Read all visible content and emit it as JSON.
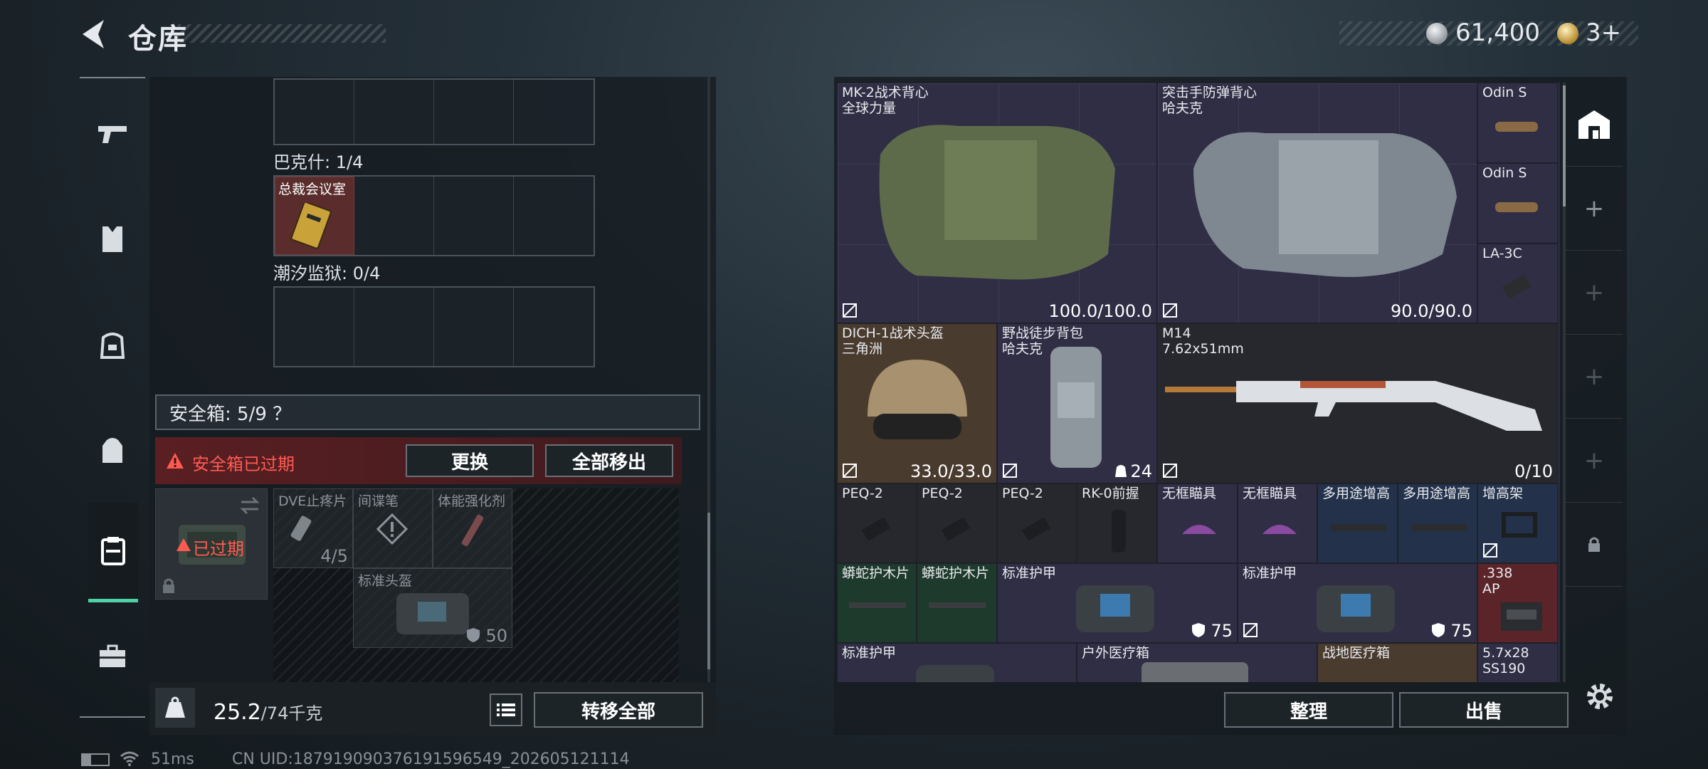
{
  "header": {
    "title": "仓库",
    "silver": "61,400",
    "gold": "3+"
  },
  "left": {
    "bakshi_label": "巴克什: 1/4",
    "key_item_label": "总裁会议室",
    "prison_label": "潮汐监狱: 0/4",
    "safe_label": "安全箱: 5/9 ？",
    "expired_msg": "安全箱已过期",
    "replace_btn": "更换",
    "remove_all_btn": "全部移出",
    "expired_badge": "已过期",
    "safe_items": [
      {
        "name": "DVE止疼片",
        "count": "4/5"
      },
      {
        "name": "间谍笔"
      },
      {
        "name": "体能强化剂"
      },
      {
        "name": "标准头盔",
        "value": "50"
      }
    ],
    "weight_value": "25.2",
    "weight_max": "/74千克",
    "transfer_all_btn": "转移全部"
  },
  "right": {
    "items": [
      {
        "line1": "MK-2战术背心",
        "line2": "全球力量",
        "value": "100.0/100.0"
      },
      {
        "line1": "突击手防弹背心",
        "line2": "哈夫克",
        "value": "90.0/90.0"
      },
      {
        "line1": "Odin S"
      },
      {
        "line1": "Odin S"
      },
      {
        "line1": "LA-3C"
      },
      {
        "line1": "DICH-1战术头盔",
        "line2": "三角洲",
        "value": "33.0/33.0"
      },
      {
        "line1": "野战徒步背包",
        "line2": "哈夫克",
        "value": "24"
      },
      {
        "line1": "M14",
        "line2": "7.62x51mm",
        "value": "0/10"
      },
      {
        "line1": "PEQ-2"
      },
      {
        "line1": "PEQ-2"
      },
      {
        "line1": "PEQ-2"
      },
      {
        "line1": "RK-0前握"
      },
      {
        "line1": "无框瞄具"
      },
      {
        "line1": "无框瞄具"
      },
      {
        "line1": "多用途增高"
      },
      {
        "line1": "多用途增高"
      },
      {
        "line1": "增高架"
      },
      {
        "line1": "蟒蛇护木片"
      },
      {
        "line1": "蟒蛇护木片"
      },
      {
        "line1": "标准护甲",
        "value": "75"
      },
      {
        "line1": "标准护甲",
        "value": "75"
      },
      {
        "line1": ".338",
        "line2": "AP"
      },
      {
        "line1": "标准护甲"
      },
      {
        "line1": "户外医疗箱"
      },
      {
        "line1": "战地医疗箱"
      },
      {
        "line1": "5.7x28",
        "line2": "SS190"
      }
    ],
    "sort_btn": "整理",
    "sell_btn": "出售"
  },
  "status": {
    "ping": "51ms",
    "uid": "CN UID:1879190903761915965​49_202605121114"
  },
  "colors": {
    "accent": "#4fd2a5",
    "warning": "#ff5a52"
  }
}
